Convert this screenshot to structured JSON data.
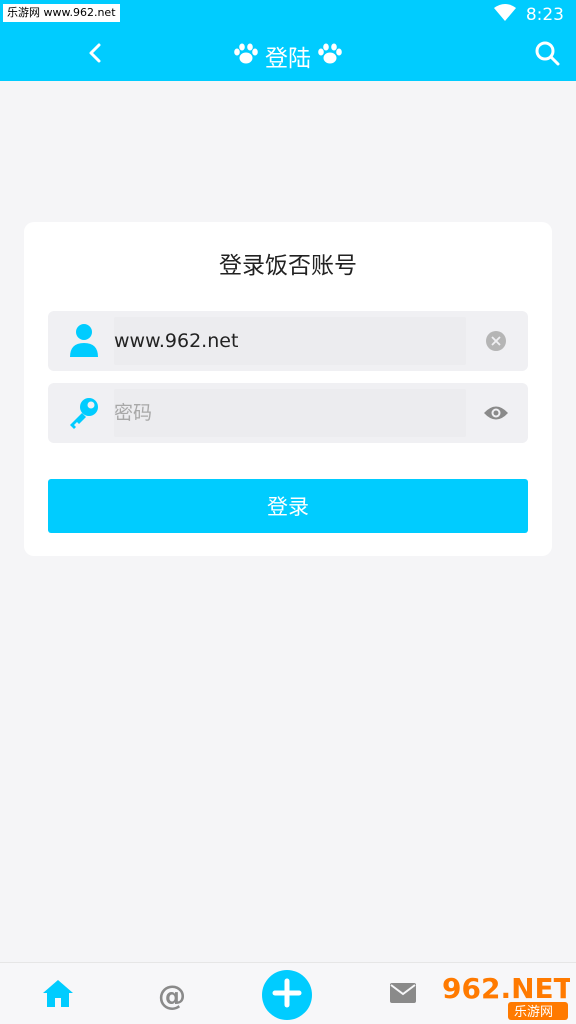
{
  "status_bar": {
    "watermark": "乐游网 www.962.net",
    "time": "8:23",
    "icons": [
      "wifi-icon",
      "battery-icon"
    ]
  },
  "app_bar": {
    "title": "登陆",
    "left_icon": "back-icon",
    "right_icon": "search-icon",
    "title_decoration": "paw-icon"
  },
  "login_card": {
    "title": "登录饭否账号",
    "username": {
      "value": "www.962.net",
      "icon": "user-icon",
      "action_icon": "clear-icon"
    },
    "password": {
      "placeholder": "密码",
      "icon": "key-icon",
      "action_icon": "eye-icon"
    },
    "submit_label": "登录"
  },
  "bottom_nav": {
    "items": [
      {
        "name": "home",
        "icon": "home-icon",
        "label": "@"
      },
      {
        "name": "mentions",
        "icon": "at-icon",
        "label": "@"
      },
      {
        "name": "compose",
        "icon": "plus-icon"
      },
      {
        "name": "messages",
        "icon": "mail-icon"
      }
    ]
  },
  "brand_mark": {
    "text": "962.NET",
    "subtext": "乐游网"
  },
  "colors": {
    "accent": "#00ccff",
    "background": "#f5f5f7",
    "field_bg": "#f0f0f3",
    "icon_grey": "#8a8a8a"
  }
}
